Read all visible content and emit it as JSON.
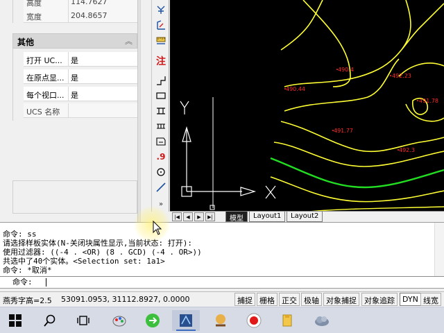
{
  "properties": {
    "top_rows": [
      {
        "key": "高度",
        "value": "114.7627"
      },
      {
        "key": "宽度",
        "value": "204.8657"
      }
    ],
    "section_title": "其他",
    "section_rows": [
      {
        "key": "打开 UC...",
        "value": "是"
      },
      {
        "key": "在原点显...",
        "value": "是"
      },
      {
        "key": "每个视口...",
        "value": "是"
      },
      {
        "key": "UCS 名称",
        "value": ""
      }
    ]
  },
  "toolbar": {
    "icons": [
      "attribute-icon",
      "dimension-icon",
      "ruler-icon",
      "annotation-icon",
      "step-icon",
      "rectangle-icon",
      "columns-icon",
      "grid-icon",
      "layout-icon",
      "decimal-icon",
      "circle-icon",
      "line-icon",
      "expand-icon"
    ],
    "annotation_label": "注",
    "decimal_label": ".9"
  },
  "drawing": {
    "elevations": [
      "490.4",
      "492.23",
      "490.44",
      "491.78",
      "491.77",
      "492.3"
    ],
    "axis_y": "Y",
    "axis_x": "X"
  },
  "tabs": {
    "model": "模型",
    "layouts": [
      "Layout1",
      "Layout2"
    ]
  },
  "command": {
    "history": [
      "命令: ss",
      "请选择样板实体(N-关闭块属性显示,当前状态: 打开):",
      "使用过滤器: ((-4 . <OR) (8 . GCD) (-4 . OR>))",
      "共选中了40个实体。<Selection set: 1a1>",
      "命令: *取消*"
    ],
    "prompt": "命令:"
  },
  "status": {
    "text_height": "燕秀字高=2.5",
    "coords": "53091.0953, 31112.8927, 0.0000",
    "toggles": [
      {
        "label": "捕捉",
        "on": false
      },
      {
        "label": "栅格",
        "on": false
      },
      {
        "label": "正交",
        "on": false
      },
      {
        "label": "极轴",
        "on": false
      },
      {
        "label": "对象捕捉",
        "on": false
      },
      {
        "label": "对象追踪",
        "on": false
      },
      {
        "label": "DYN",
        "on": true
      },
      {
        "label": "线宽",
        "on": false
      }
    ]
  },
  "taskbar": {
    "items": [
      "windows-start-icon",
      "search-icon",
      "task-view-icon",
      "paint-app-icon",
      "green-app-icon",
      "cad-app-icon",
      "game-app-icon",
      "record-app-icon",
      "file-explorer-icon",
      "cloud-app-icon"
    ],
    "active_index": 5
  },
  "colors": {
    "canvas_bg": "#000000",
    "contour_yellow": "#ffff33",
    "contour_green": "#22dd22",
    "elevation_red": "#ff2a2a",
    "ucs_white": "#ffffff"
  }
}
